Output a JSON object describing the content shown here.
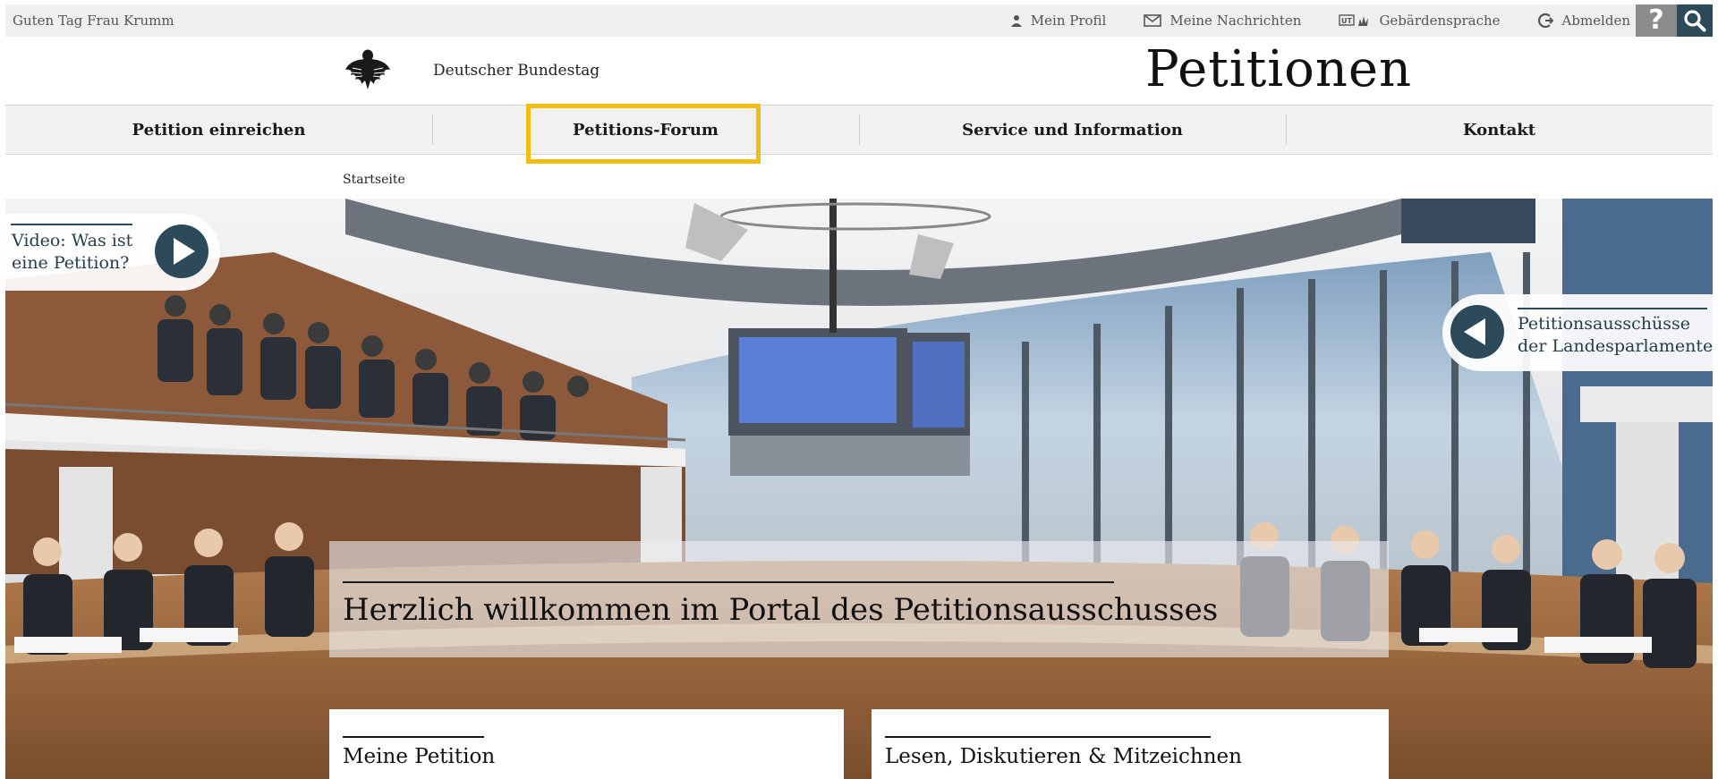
{
  "utility": {
    "greeting": "Guten Tag Frau Krumm",
    "links": [
      {
        "label": "Mein Profil",
        "icon": "user-icon"
      },
      {
        "label": "Meine Nachrichten",
        "icon": "envelope-icon"
      },
      {
        "label": "Gebärdensprache",
        "icon": "sign-language-icon"
      },
      {
        "label": "Abmelden",
        "icon": "logout-icon"
      }
    ],
    "help_symbol": "?"
  },
  "header": {
    "org_name": "Deutscher Bundestag",
    "site_title": "Petitionen"
  },
  "nav": {
    "items": [
      {
        "label": "Petition einreichen"
      },
      {
        "label": "Petitions-Forum",
        "highlighted": true
      },
      {
        "label": "Service und Information"
      },
      {
        "label": "Kontakt"
      }
    ]
  },
  "breadcrumb": "Startseite",
  "hero": {
    "video_label": "Video: Was ist eine Petition?",
    "laender_label_line1": "Petitionsausschüsse",
    "laender_label_line2": "der Landesparlamente",
    "welcome": "Herzlich willkommen im Portal des Petitionsausschusses"
  },
  "cards": [
    {
      "title": "Meine Petition"
    },
    {
      "title": "Lesen, Diskutieren & Mitzeichnen"
    }
  ],
  "colors": {
    "accent_dark": "#2d4a5a",
    "highlight": "#f3bd12",
    "utility_bg": "#efefef",
    "nav_bg": "#f2f2f2"
  }
}
